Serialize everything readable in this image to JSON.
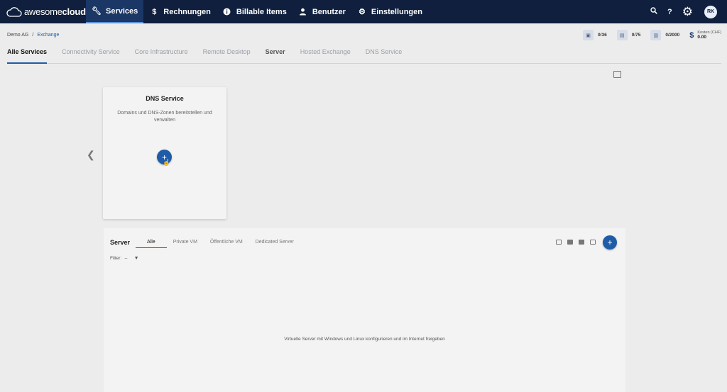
{
  "nav": {
    "logo_prefix": "awesome",
    "logo_suffix": "cloud",
    "items": [
      {
        "label": "Services",
        "icon": "wrench-icon",
        "active": true
      },
      {
        "label": "Rechnungen",
        "icon": "dollar-icon"
      },
      {
        "label": "Billable Items",
        "icon": "info-icon"
      },
      {
        "label": "Benutzer",
        "icon": "user-icon"
      },
      {
        "label": "Einstellungen",
        "icon": "gear-icon"
      }
    ],
    "avatar": "RK"
  },
  "breadcrumb": {
    "root": "Demo AG",
    "sep": "/",
    "current": "Exchange"
  },
  "stats": [
    {
      "icon": "cpu-icon",
      "value": "0/36"
    },
    {
      "icon": "memory-icon",
      "value": "0/75"
    },
    {
      "icon": "storage-icon",
      "value": "0/2000"
    }
  ],
  "cost": {
    "label": "Kosten (CHF)",
    "value": "0.00"
  },
  "tabs": [
    "Alle Services",
    "Connectivity Service",
    "Core Infrastructure",
    "Remote Desktop",
    "Server",
    "Hosted Exchange",
    "DNS Service"
  ],
  "dns_card": {
    "title": "DNS Service",
    "desc": "Domains und DNS-Zonen bereitstellen und verwalten",
    "add": "+"
  },
  "server": {
    "title": "Server",
    "tabs": [
      "Alle",
      "Private VM",
      "Öffentliche VM",
      "Dedicated Server"
    ],
    "filter_label": "Filter:",
    "filter_value": "--",
    "add": "+",
    "empty_message": "Virtuelle Server mit Windows und Linux konfigurieren und im Internet freigeben"
  },
  "colors": {
    "nav_bg": "#0f1f3d",
    "accent": "#1f5ca8",
    "page_bg": "#ececec"
  }
}
